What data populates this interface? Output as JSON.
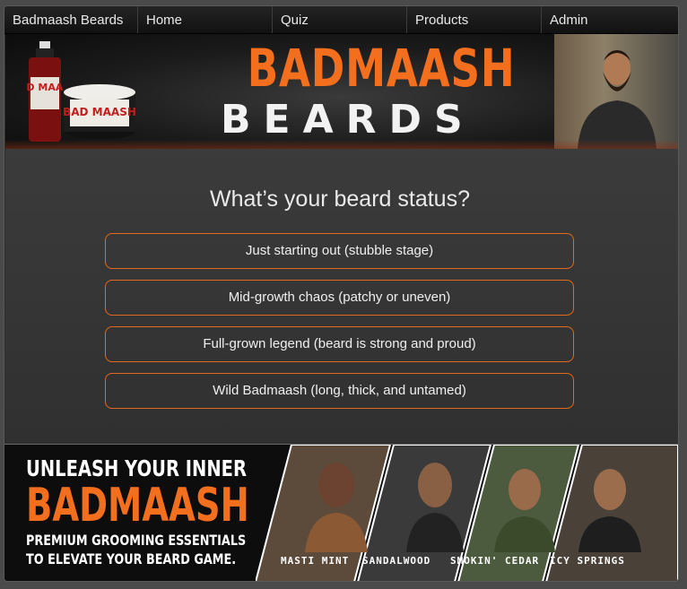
{
  "nav": {
    "brand": "Badmaash Beards",
    "items": [
      "Home",
      "Quiz",
      "Products",
      "Admin"
    ]
  },
  "top_banner": {
    "brand_line1": "BADMAASH",
    "brand_line2": "BEARDS",
    "product_bottle_label": "BAD MAASH",
    "product_tin_label": "BAD MAASH"
  },
  "quiz": {
    "question": "What’s your beard status?",
    "options": [
      "Just starting out (stubble stage)",
      "Mid-growth chaos (patchy or uneven)",
      "Full-grown legend (beard is strong and proud)",
      "Wild Badmaash (long, thick, and untamed)"
    ]
  },
  "bottom_banner": {
    "line1": "UNLEASH YOUR INNER",
    "line2": "BADMAASH",
    "line3": "PREMIUM GROOMING ESSENTIALS",
    "line4": "TO ELEVATE YOUR BEARD GAME.",
    "products": [
      "MASTI MINT",
      "SANDALWOOD",
      "SMOKIN' CEDAR",
      "ICY SPRINGS"
    ]
  },
  "colors": {
    "accent": "#f36f1e",
    "background": "#2b2b2b",
    "text": "#eaeaea"
  }
}
